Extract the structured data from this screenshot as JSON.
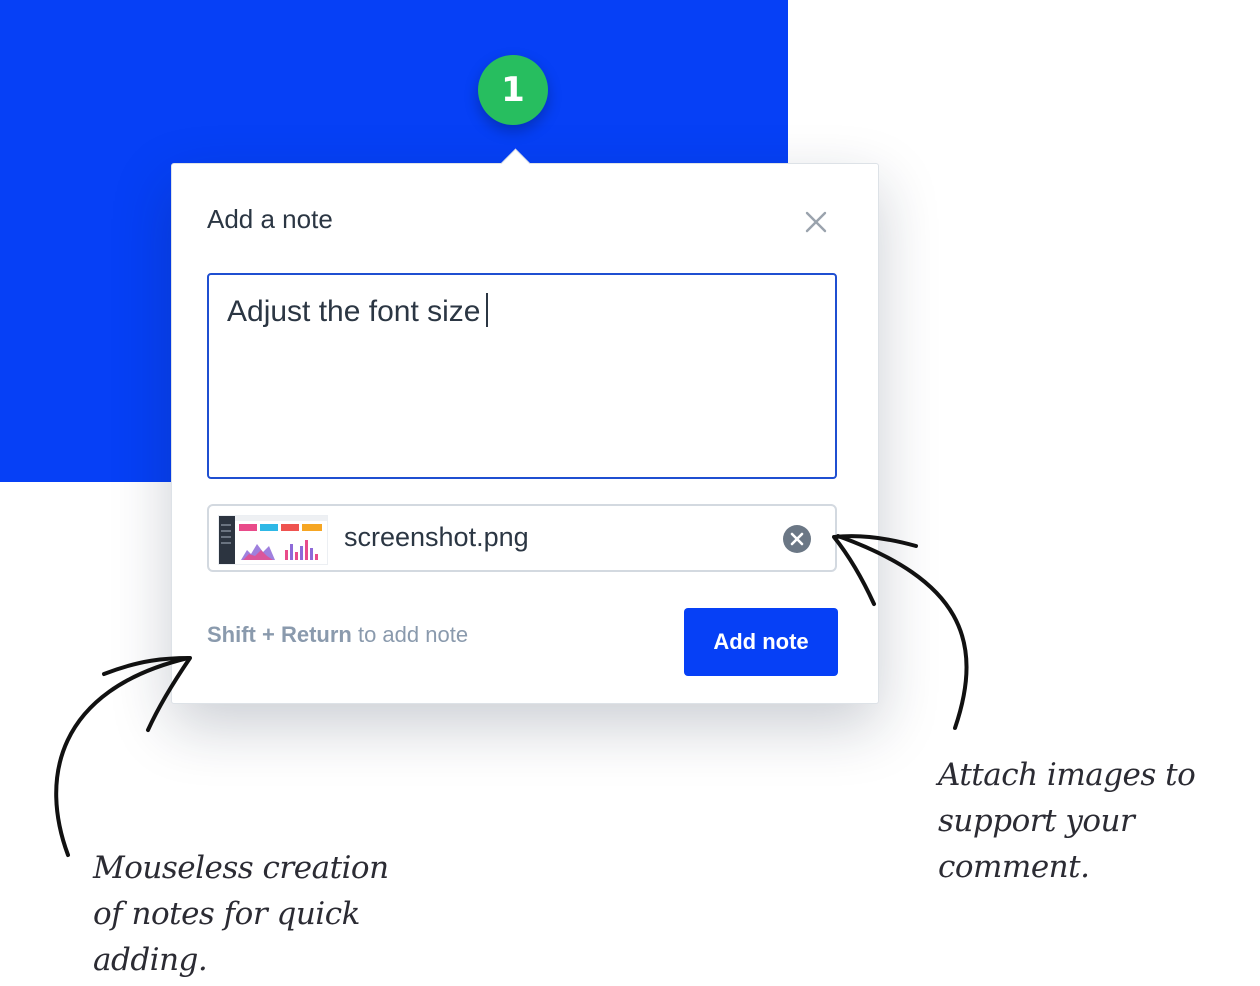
{
  "marker": {
    "number": "1",
    "color": "#27be5f"
  },
  "note": {
    "title": "Add a note",
    "text": "Adjust the font size",
    "attachment": {
      "file_name": "screenshot.png"
    },
    "hint": {
      "keys": "Shift + Return",
      "suffix": " to add note"
    },
    "submit_label": "Add note"
  },
  "annotations": {
    "left": [
      "Mouseless creation",
      "of notes for quick",
      "adding."
    ],
    "right": [
      "Attach images to",
      "support your comment."
    ]
  },
  "colors": {
    "brand_blue": "#0640f6",
    "text": "#2b3643",
    "muted": "#8a9aad"
  },
  "icons": {
    "close": "close-icon",
    "remove": "remove-attachment-icon"
  }
}
